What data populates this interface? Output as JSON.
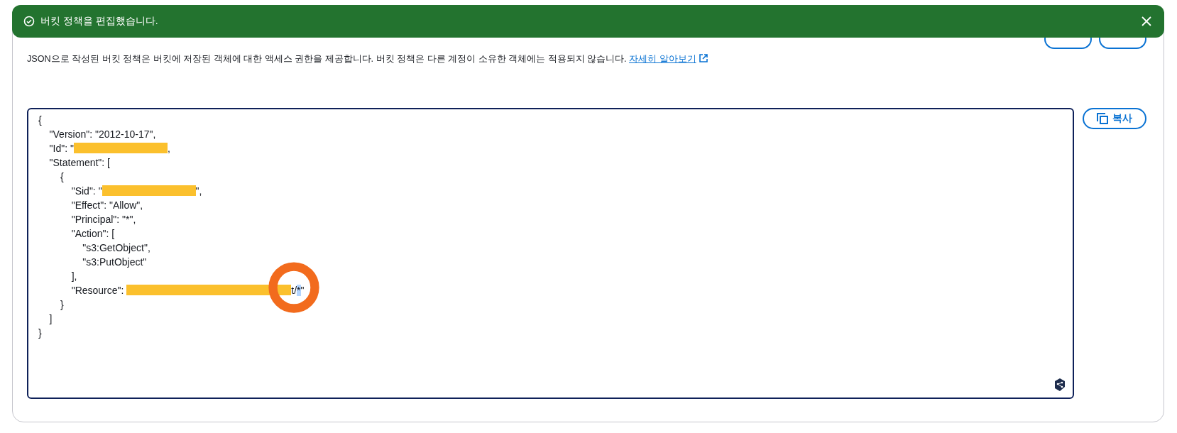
{
  "toast": {
    "message": "버킷 정책을 편집했습니다."
  },
  "description": {
    "text": "JSON으로 작성된 버킷 정책은 버킷에 저장된 객체에 대한 액세스 권한을 제공합니다. 버킷 정책은 다른 계정이 소유한 객체에는 적용되지 않습니다.",
    "link": "자세히 알아보기"
  },
  "editor": {
    "lines": [
      [
        {
          "kind": "text",
          "text": "{"
        }
      ],
      [
        {
          "kind": "text",
          "text": "    \"Version\": \"2012-10-17\","
        }
      ],
      [
        {
          "kind": "text",
          "text": "    \"Id\": \""
        },
        {
          "kind": "redacted"
        },
        {
          "kind": "text",
          "text": ","
        }
      ],
      [
        {
          "kind": "text",
          "text": "    \"Statement\": ["
        }
      ],
      [
        {
          "kind": "text",
          "text": "        {"
        }
      ],
      [
        {
          "kind": "text",
          "text": "            \"Sid\": \""
        },
        {
          "kind": "redacted"
        },
        {
          "kind": "text",
          "text": "\","
        }
      ],
      [
        {
          "kind": "text",
          "text": "            \"Effect\": \"Allow\","
        }
      ],
      [
        {
          "kind": "text",
          "text": "            \"Principal\": \"*\","
        }
      ],
      [
        {
          "kind": "text",
          "text": "            \"Action\": ["
        }
      ],
      [
        {
          "kind": "text",
          "text": "                \"s3:GetObject\","
        }
      ],
      [
        {
          "kind": "text",
          "text": "                \"s3:PutObject\""
        }
      ],
      [
        {
          "kind": "text",
          "text": "            ],"
        }
      ],
      [
        {
          "kind": "text",
          "text": "            \"Resource\": "
        },
        {
          "kind": "redacted",
          "long": true
        },
        {
          "kind": "text",
          "text": "t/"
        },
        {
          "kind": "selected",
          "text": "*"
        },
        {
          "kind": "text",
          "text": "\""
        }
      ],
      [
        {
          "kind": "text",
          "text": "        }"
        }
      ],
      [
        {
          "kind": "text",
          "text": "    ]"
        }
      ],
      [
        {
          "kind": "text",
          "text": "}"
        }
      ]
    ]
  },
  "copy_button": {
    "label": "복사"
  }
}
